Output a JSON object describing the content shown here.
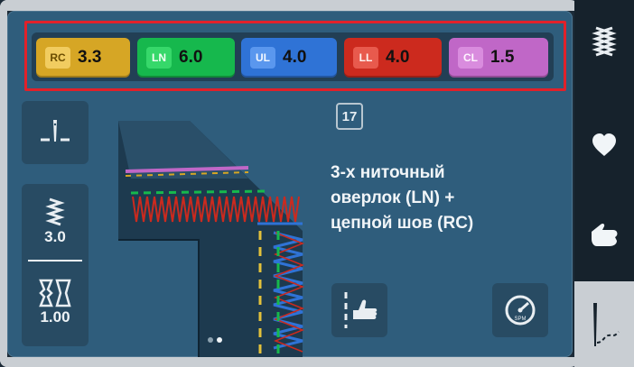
{
  "tensions": [
    {
      "code": "RC",
      "value": "3.3",
      "bg": "#d6a625",
      "tag_bg": "#f1cc60",
      "tag_color": "#6b4d00"
    },
    {
      "code": "LN",
      "value": "6.0",
      "bg": "#16b84d",
      "tag_bg": "#36d86a",
      "tag_color": "#f2fff5"
    },
    {
      "code": "UL",
      "value": "4.0",
      "bg": "#2f73d6",
      "tag_bg": "#5a97ee",
      "tag_color": "#f3f8ff"
    },
    {
      "code": "LL",
      "value": "4.0",
      "bg": "#cc2a1e",
      "tag_bg": "#e85a4d",
      "tag_color": "#fff1ef"
    },
    {
      "code": "CL",
      "value": "1.5",
      "bg": "#c067c7",
      "tag_bg": "#d98cde",
      "tag_color": "#fff4ff"
    }
  ],
  "stitch": {
    "number": "17",
    "description_lines": [
      "3-х ниточный",
      "оверлок (LN) +",
      "цепной шов (RC)"
    ]
  },
  "settings": {
    "stitch_length": "3.0",
    "differential_feed": "1.00"
  },
  "icons": {
    "needle_position": "needle-position-icon",
    "stitch_length": "stitch-length-icon",
    "differential_feed": "differential-feed-icon",
    "hand_guide": "hand-guide-icon",
    "speed": "speed-icon",
    "stitch_type": "stitch-type-icon",
    "favorite": "heart-icon",
    "help": "hand-icon",
    "threading": "threading-icon"
  },
  "speed_label": "SPM",
  "page_indicator": {
    "count": 2,
    "active": 1
  },
  "colors": {
    "highlight": "#e1212a",
    "panel": "#2f5d7c"
  }
}
